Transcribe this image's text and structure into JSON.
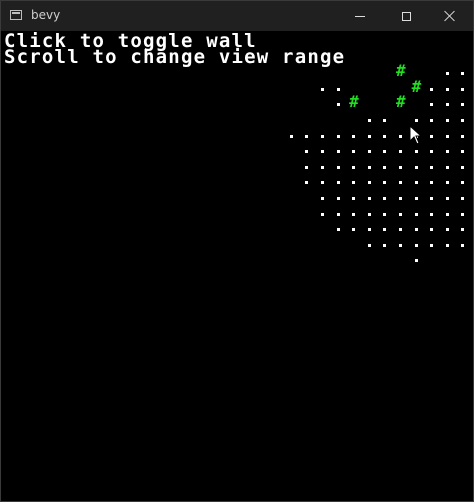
{
  "window": {
    "title": "bevy",
    "controls": {
      "minimize_icon": "minimize-icon",
      "maximize_icon": "maximize-icon",
      "close_icon": "close-icon"
    }
  },
  "hud": {
    "line1": "Click to toggle wall",
    "line2": "Scroll to change view range"
  },
  "colors": {
    "background": "#000000",
    "floor_dot": "#ffffff",
    "wall": "#22dd22",
    "titlebar": "#202020"
  },
  "map": {
    "wall_glyph": "#",
    "floor_glyph": ".",
    "rows": [
      "..............................",
      "..............................",
      "...................##.#....#..",
      "...............#..#.#.........",
      "...................#.......#..",
      "..................#..#........",
      "..............................",
      "..............................",
      "..............................",
      "..............................",
      "..............................",
      "..............................",
      "..............................",
      "..............................",
      "..............................",
      "..............................",
      "..............................",
      "..............................",
      "..............................",
      "..............................",
      "..............................",
      "..............................",
      "..............................",
      "..............................",
      "..............................",
      "..............................",
      "..............................",
      "..............................",
      "..............................",
      ".............................."
    ],
    "visible_floor": [
      [
        2,
        28
      ],
      [
        2,
        29
      ],
      [
        3,
        20
      ],
      [
        3,
        21
      ],
      [
        3,
        27
      ],
      [
        3,
        28
      ],
      [
        3,
        29
      ],
      [
        4,
        21
      ],
      [
        4,
        22
      ],
      [
        4,
        25
      ],
      [
        4,
        27
      ],
      [
        4,
        28
      ],
      [
        4,
        29
      ],
      [
        5,
        23
      ],
      [
        5,
        24
      ],
      [
        5,
        26
      ],
      [
        5,
        27
      ],
      [
        5,
        28
      ],
      [
        5,
        29
      ],
      [
        6,
        18
      ],
      [
        6,
        19
      ],
      [
        6,
        20
      ],
      [
        6,
        21
      ],
      [
        6,
        22
      ],
      [
        6,
        23
      ],
      [
        6,
        24
      ],
      [
        6,
        25
      ],
      [
        6,
        26
      ],
      [
        6,
        27
      ],
      [
        6,
        28
      ],
      [
        6,
        29
      ],
      [
        7,
        19
      ],
      [
        7,
        20
      ],
      [
        7,
        21
      ],
      [
        7,
        22
      ],
      [
        7,
        23
      ],
      [
        7,
        24
      ],
      [
        7,
        25
      ],
      [
        7,
        26
      ],
      [
        7,
        27
      ],
      [
        7,
        28
      ],
      [
        7,
        29
      ],
      [
        8,
        19
      ],
      [
        8,
        20
      ],
      [
        8,
        21
      ],
      [
        8,
        22
      ],
      [
        8,
        23
      ],
      [
        8,
        24
      ],
      [
        8,
        25
      ],
      [
        8,
        26
      ],
      [
        8,
        27
      ],
      [
        8,
        28
      ],
      [
        8,
        29
      ],
      [
        9,
        19
      ],
      [
        9,
        20
      ],
      [
        9,
        21
      ],
      [
        9,
        22
      ],
      [
        9,
        23
      ],
      [
        9,
        24
      ],
      [
        9,
        25
      ],
      [
        9,
        26
      ],
      [
        9,
        27
      ],
      [
        9,
        28
      ],
      [
        9,
        29
      ],
      [
        10,
        20
      ],
      [
        10,
        21
      ],
      [
        10,
        22
      ],
      [
        10,
        23
      ],
      [
        10,
        24
      ],
      [
        10,
        25
      ],
      [
        10,
        26
      ],
      [
        10,
        27
      ],
      [
        10,
        28
      ],
      [
        10,
        29
      ],
      [
        11,
        20
      ],
      [
        11,
        21
      ],
      [
        11,
        22
      ],
      [
        11,
        23
      ],
      [
        11,
        24
      ],
      [
        11,
        25
      ],
      [
        11,
        26
      ],
      [
        11,
        27
      ],
      [
        11,
        28
      ],
      [
        11,
        29
      ],
      [
        12,
        21
      ],
      [
        12,
        22
      ],
      [
        12,
        23
      ],
      [
        12,
        24
      ],
      [
        12,
        25
      ],
      [
        12,
        26
      ],
      [
        12,
        27
      ],
      [
        12,
        28
      ],
      [
        12,
        29
      ],
      [
        13,
        23
      ],
      [
        13,
        24
      ],
      [
        13,
        25
      ],
      [
        13,
        26
      ],
      [
        13,
        27
      ],
      [
        13,
        28
      ],
      [
        13,
        29
      ],
      [
        14,
        26
      ]
    ],
    "visible_walls": [
      [
        2,
        25
      ],
      [
        3,
        26
      ],
      [
        4,
        22
      ],
      [
        4,
        25
      ]
    ]
  }
}
